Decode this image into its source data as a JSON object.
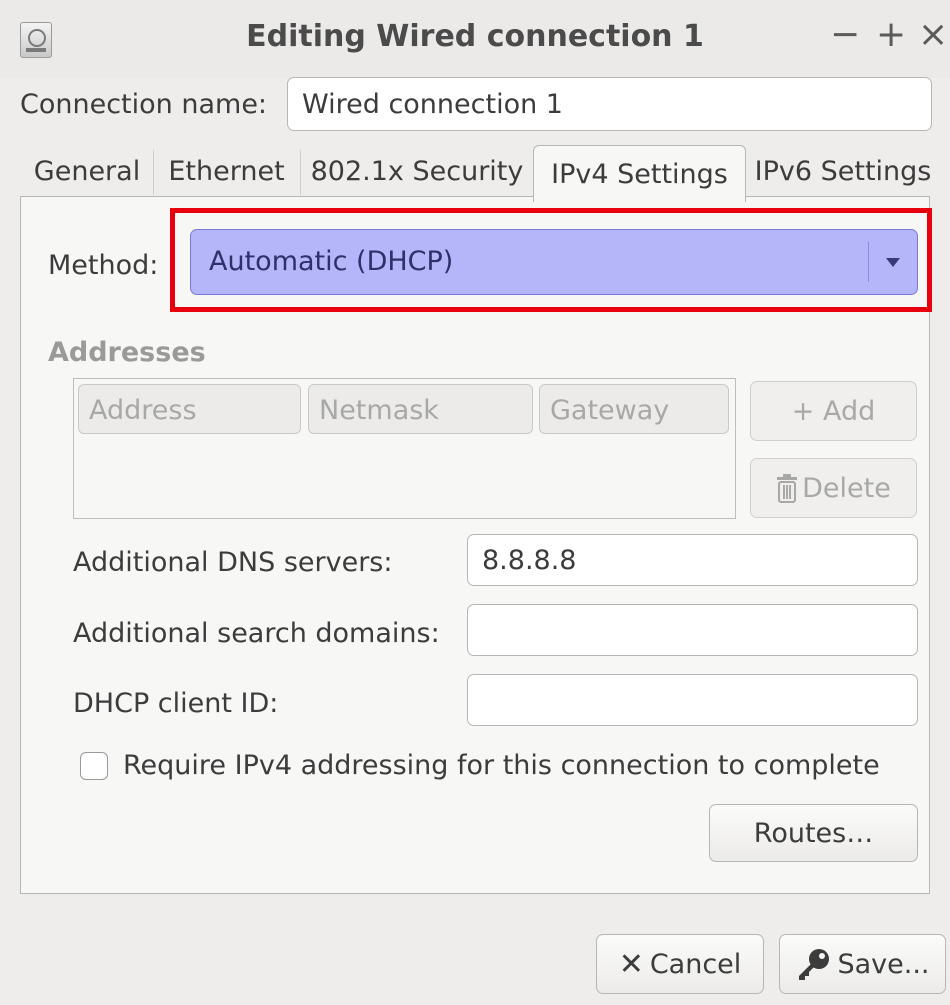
{
  "window": {
    "title": "Editing Wired connection 1",
    "controls": {
      "minimize": "−",
      "maximize": "+",
      "close": "×"
    }
  },
  "connection_name": {
    "label": "Connection name:",
    "value": "Wired connection 1"
  },
  "tabs": [
    {
      "label": "General",
      "active": false
    },
    {
      "label": "Ethernet",
      "active": false
    },
    {
      "label": "802.1x Security",
      "active": false
    },
    {
      "label": "IPv4 Settings",
      "active": true
    },
    {
      "label": "IPv6 Settings",
      "active": false
    }
  ],
  "method": {
    "label": "Method:",
    "value": "Automatic (DHCP)"
  },
  "addresses": {
    "section_label": "Addresses",
    "columns": [
      "Address",
      "Netmask",
      "Gateway"
    ],
    "add_label": "+ Add",
    "delete_label": "Delete"
  },
  "dns": {
    "label": "Additional DNS servers:",
    "value": "8.8.8.8"
  },
  "search_domains": {
    "label": "Additional search domains:",
    "value": ""
  },
  "dhcp_client_id": {
    "label": "DHCP client ID:",
    "value": ""
  },
  "require_ipv4": {
    "label": "Require IPv4 addressing for this connection to complete",
    "checked": false
  },
  "routes_label": "Routes…",
  "footer": {
    "cancel_label": "Cancel",
    "save_label": "Save..."
  },
  "colors": {
    "highlight": "#e8000f",
    "combo_background": "#b5b5f9"
  },
  "icons": {
    "app": "network-icon",
    "trash": "trash-icon",
    "cancel": "x-icon",
    "save": "key-icon"
  }
}
